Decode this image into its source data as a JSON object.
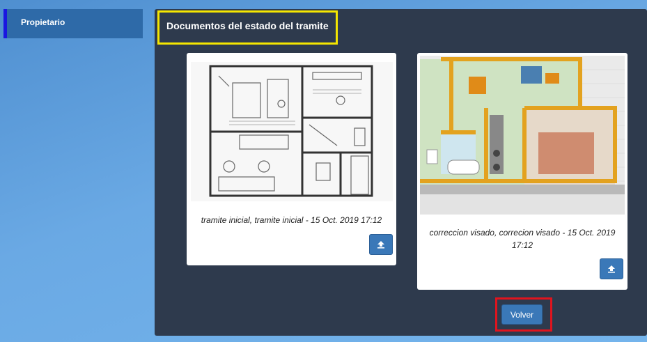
{
  "sidebar": {
    "item_label": "Propietario"
  },
  "panel": {
    "title": "Documentos del estado del tramite"
  },
  "documents": [
    {
      "caption": "tramite inicial, tramite inicial - 15 Oct. 2019 17:12",
      "upload_icon": "upload-icon"
    },
    {
      "caption": "correccion visado, correcion visado - 15 Oct. 2019 17:12",
      "upload_icon": "upload-icon"
    }
  ],
  "actions": {
    "back_label": "Volver"
  },
  "colors": {
    "panel_bg": "#2e3a4d",
    "button": "#3a78b8",
    "title_highlight": "#f5e600",
    "back_highlight": "#e0141e",
    "sidebar_accent": "#1a16e0"
  }
}
